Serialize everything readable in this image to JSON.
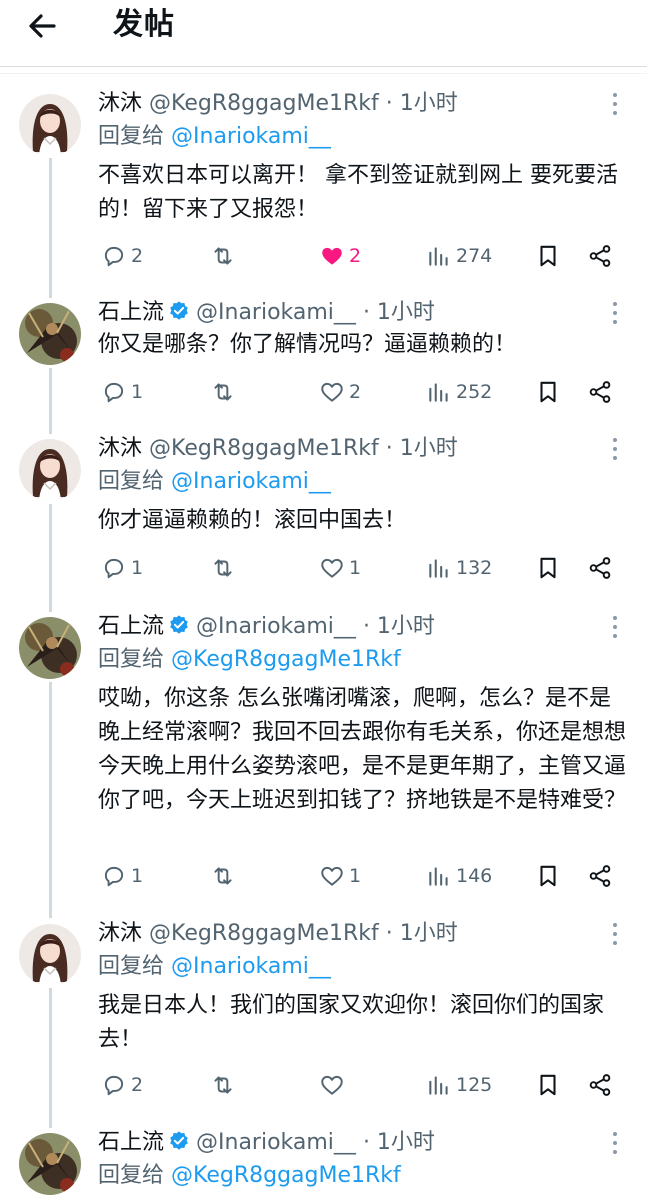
{
  "header": {
    "title": "发帖"
  },
  "reply_prefix": "回复给",
  "tweets": [
    {
      "name": "沐沐",
      "handle": "@KegR8ggagMe1Rkf",
      "time": "· 1小时",
      "verified": false,
      "reply_to": "@Inariokami__",
      "text": "不喜欢日本可以离开！ 拿不到签证就到网上 要死要活的！留下来了又报怨！",
      "replies": "2",
      "retweets": "",
      "likes": "2",
      "liked": true,
      "views": "274"
    },
    {
      "name": "石上流",
      "handle": "@Inariokami__",
      "time": "· 1小时",
      "verified": true,
      "reply_to": "",
      "text": "你又是哪条？你了解情况吗？逼逼赖赖的！",
      "replies": "1",
      "retweets": "",
      "likes": "2",
      "liked": false,
      "views": "252"
    },
    {
      "name": "沐沐",
      "handle": "@KegR8ggagMe1Rkf",
      "time": "· 1小时",
      "verified": false,
      "reply_to": "@Inariokami__",
      "text": "你才逼逼赖赖的！滚回中国去！",
      "replies": "1",
      "retweets": "",
      "likes": "1",
      "liked": false,
      "views": "132"
    },
    {
      "name": "石上流",
      "handle": "@Inariokami__",
      "time": "· 1小时",
      "verified": true,
      "reply_to": "@KegR8ggagMe1Rkf",
      "text": "哎呦，你这条 怎么张嘴闭嘴滚，爬啊，怎么？是不是晚上经常滚啊？我回不回去跟你有毛关系，你还是想想今天晚上用什么姿势滚吧，是不是更年期了，主管又逼你了吧，今天上班迟到扣钱了？挤地铁是不是特难受？",
      "replies": "1",
      "retweets": "",
      "likes": "1",
      "liked": false,
      "views": "146"
    },
    {
      "name": "沐沐",
      "handle": "@KegR8ggagMe1Rkf",
      "time": "· 1小时",
      "verified": false,
      "reply_to": "@Inariokami__",
      "text": "我是日本人！我们的国家又欢迎你！滚回你们的国家去！",
      "replies": "2",
      "retweets": "",
      "likes": "",
      "liked": false,
      "views": "125"
    },
    {
      "name": "石上流",
      "handle": "@Inariokami__",
      "time": "· 1小时",
      "verified": true,
      "reply_to": "@KegR8ggagMe1Rkf",
      "text": "",
      "replies": "",
      "retweets": "",
      "likes": "",
      "liked": false,
      "views": ""
    }
  ],
  "colors": {
    "text": "#0f1419",
    "secondary": "#536471",
    "link": "#1d9bf0",
    "like": "#f91880",
    "thread": "#cfd9de"
  }
}
